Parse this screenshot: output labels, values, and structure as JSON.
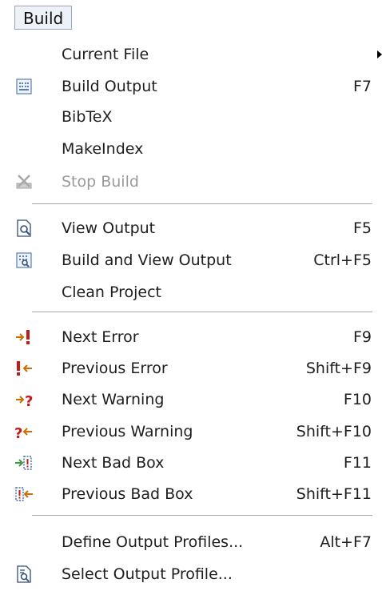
{
  "menubar": {
    "title": "Build"
  },
  "menu": {
    "groups": [
      {
        "items": [
          {
            "label": "Current File",
            "shortcut": "",
            "submenu": true,
            "icon": ""
          },
          {
            "label": "Build Output",
            "shortcut": "F7",
            "icon": "build-output-icon"
          },
          {
            "label": "BibTeX",
            "shortcut": "",
            "icon": ""
          },
          {
            "label": "MakeIndex",
            "shortcut": "",
            "icon": ""
          },
          {
            "label": "Stop Build",
            "shortcut": "",
            "disabled": true,
            "icon": "stop-build-icon"
          }
        ]
      },
      {
        "items": [
          {
            "label": "View Output",
            "shortcut": "F5",
            "icon": "view-output-icon"
          },
          {
            "label": "Build and View Output",
            "shortcut": "Ctrl+F5",
            "icon": "build-and-view-icon"
          },
          {
            "label": "Clean Project",
            "shortcut": "",
            "icon": ""
          }
        ]
      },
      {
        "items": [
          {
            "label": "Next Error",
            "shortcut": "F9",
            "icon": "next-error-icon"
          },
          {
            "label": "Previous Error",
            "shortcut": "Shift+F9",
            "icon": "previous-error-icon"
          },
          {
            "label": "Next Warning",
            "shortcut": "F10",
            "icon": "next-warning-icon"
          },
          {
            "label": "Previous Warning",
            "shortcut": "Shift+F10",
            "icon": "previous-warning-icon"
          },
          {
            "label": "Next Bad Box",
            "shortcut": "F11",
            "icon": "next-bad-box-icon"
          },
          {
            "label": "Previous Bad Box",
            "shortcut": "Shift+F11",
            "icon": "previous-bad-box-icon"
          }
        ]
      },
      {
        "items": [
          {
            "label": "Define Output Profiles...",
            "shortcut": "Alt+F7",
            "icon": ""
          },
          {
            "label": "Select Output Profile...",
            "shortcut": "",
            "icon": "select-output-profile-icon"
          }
        ]
      }
    ]
  },
  "colors": {
    "text": "#1e1e1e",
    "disabled_text": "#9a9a9a",
    "separator": "#a9a9a9",
    "icon_green": "#3c9a3c",
    "icon_red": "#c41a1a",
    "icon_orange": "#cf6e00",
    "icon_blue": "#3a6fb5"
  }
}
